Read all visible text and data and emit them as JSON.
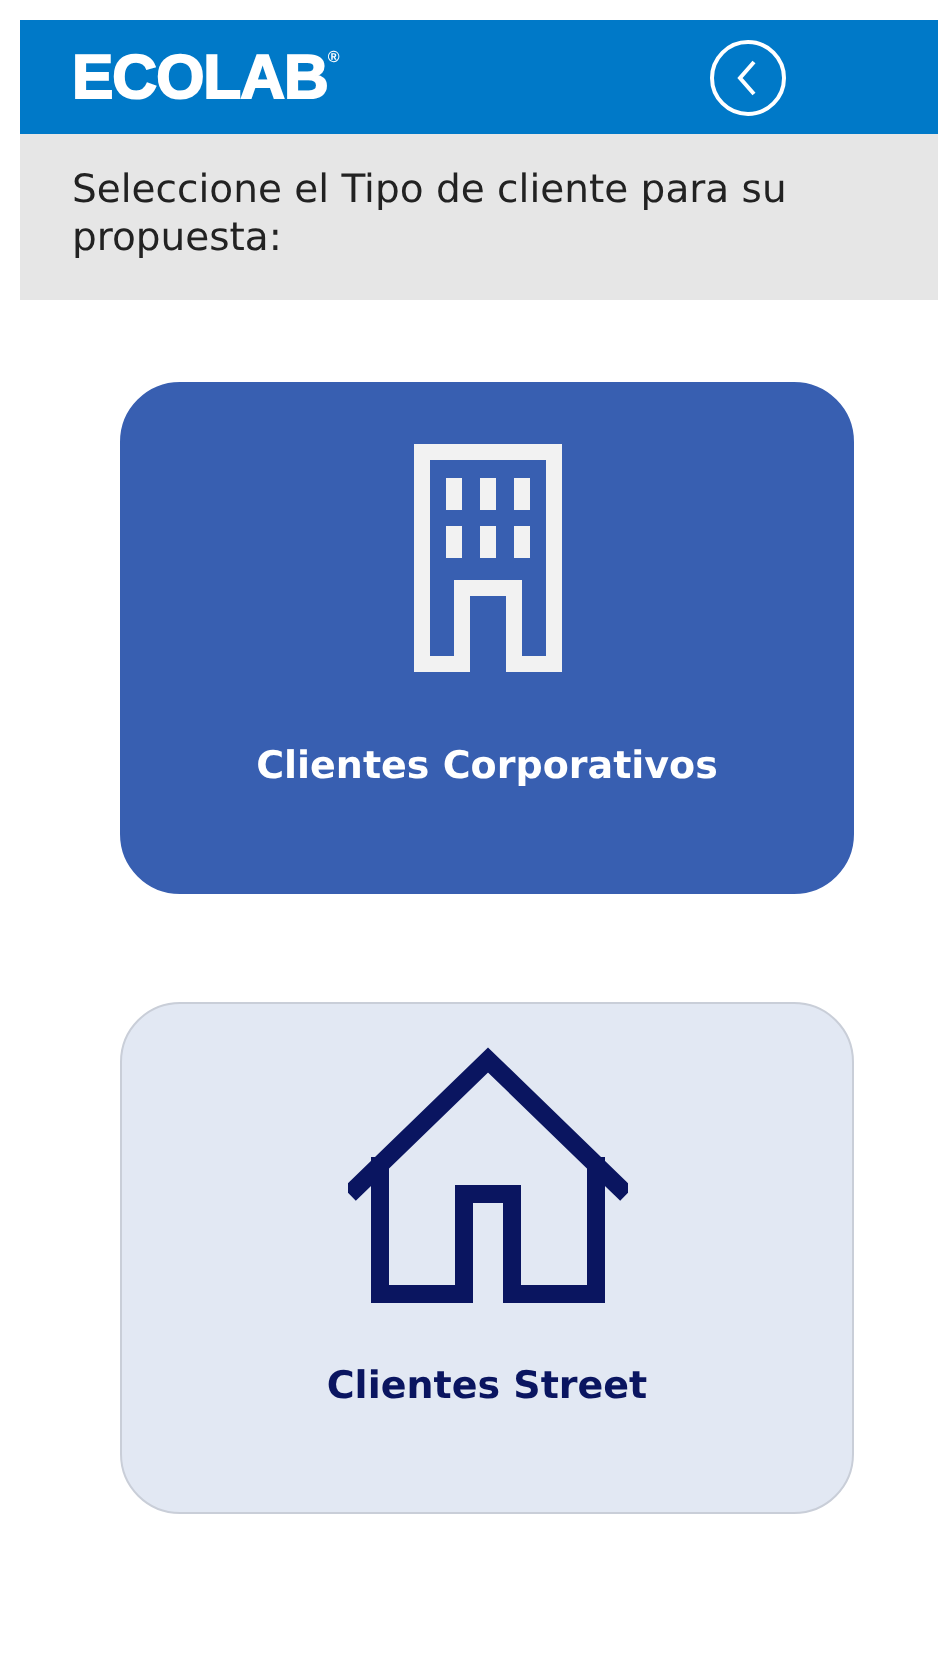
{
  "header": {
    "logo": "ECOLAB$^{®}$"
  },
  "prompt": "Seleccione el Tipo de cliente para su propuesta:",
  "options": [
    {
      "kind": "building",
      "label": "Clientes Corporativos",
      "selected": true
    },
    {
      "kind": "house",
      "label": "Clientes Street",
      "selected": false
    }
  ]
}
